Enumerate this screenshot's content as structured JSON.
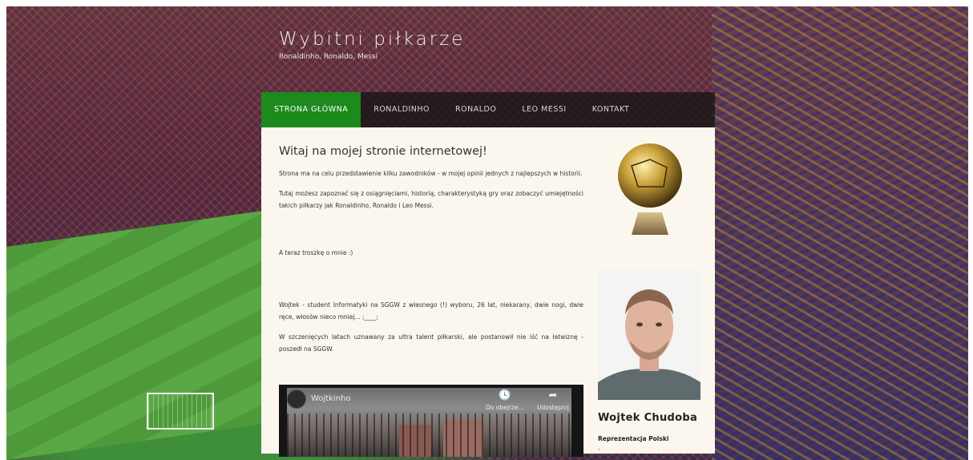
{
  "site": {
    "title": "Wybitni piłkarze",
    "subtitle": "Ronaldinho, Ronaldo, Messi"
  },
  "nav": {
    "items": [
      {
        "label": "STRONA GŁÓWNA",
        "active": true
      },
      {
        "label": "RONALDINHO",
        "active": false
      },
      {
        "label": "RONALDO",
        "active": false
      },
      {
        "label": "LEO MESSI",
        "active": false
      },
      {
        "label": "KONTAKT",
        "active": false
      }
    ]
  },
  "main": {
    "heading": "Witaj na mojej stronie internetowej!",
    "p1": "Strona ma na celu przedstawienie kilku zawodników - w mojej opinii jednych z najlepszych w historii.",
    "p2": "Tutaj możesz zapoznać się z osiągnięciami, historią, charakterystyką gry oraz zobaczyć umiejętności takich piłkarzy jak Ronaldinho, Ronaldo i Leo Messi.",
    "p3": "A teraz troszkę o mnie :)",
    "p4": "Wojtek - student Informatyki na SGGW z własnego (!) wyboru, 26 lat, niekarany, dwie nogi, dwie ręce, włosów nieco mniej... ;____;",
    "p5": "W szczenięcych latach uznawany za ultra talent piłkarski, ale postanowił nie iść na łatwiznę - poszedł na SGGW."
  },
  "video": {
    "title": "Wojtkinho",
    "watch_later": "Do obejrze...",
    "share": "Udostępnij"
  },
  "sidebar": {
    "name": "Wojtek Chudoba",
    "role": "Reprezentacja Polski",
    "dot": "-"
  },
  "colors": {
    "nav_active": "#1c8a1c",
    "content_bg": "#fbf7ee"
  }
}
